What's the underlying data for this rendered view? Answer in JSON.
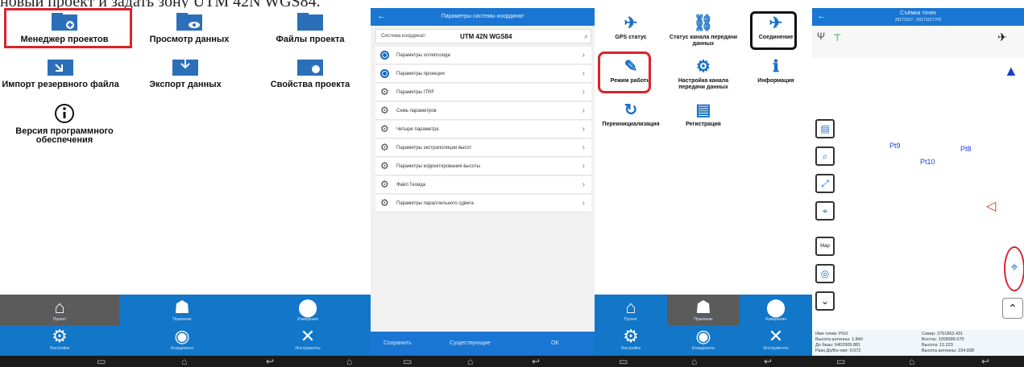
{
  "caption": "новый проект и задать зону UTM 42N WGS84.",
  "panel1": {
    "tiles": [
      "Менеджер проектов",
      "Просмотр данных",
      "Файлы проекта",
      "Импорт резервного файла",
      "Экспорт данных",
      "Свойства проекта",
      "Версия программного обеспечения"
    ],
    "bottom_tabs": [
      "Проект",
      "Приемник",
      "Измерения",
      "Настройки",
      "Координаты",
      "Инструменты"
    ]
  },
  "panel2": {
    "header_title": "Параметры системы координат",
    "coord_label": "Система координат:",
    "coord_value": "UTM 42N WGS84",
    "rows": [
      "Параметры эллипсоида",
      "Параметры проекции",
      "Параметры ITRF",
      "Семь параметров",
      "Четыре параметра",
      "Параметры экстраполяции высот",
      "Параметры корректирования высоты",
      "Файл Геоида",
      "Параметры параллельного сдвига"
    ],
    "footer": [
      "Сохранить",
      "Существующие",
      "ОК"
    ]
  },
  "panel3": {
    "tiles": [
      "GPS статус",
      "Статус канала передачи данных",
      "Соединение",
      "Режим работы",
      "Настройка канала передачи данных",
      "Информация",
      "Переинициализация",
      "Регистрация"
    ],
    "bottom_tabs": [
      "Проект",
      "Приемник",
      "Измерения",
      "Настройки",
      "Координаты",
      "Инструменты"
    ]
  },
  "panel4": {
    "title_line1": "Съёмка точек",
    "title_line2": "20171017 - 20171017 PD",
    "points": [
      "Pt9",
      "Pt8",
      "Pt10"
    ],
    "side_buttons": [
      "Map"
    ],
    "info": {
      "name": "Имя точки: Pt10",
      "antenna": "Высота антенны: 1.840",
      "lat": "До базы: 6402909.881",
      "pdop": "Разн.До/Бо-ния: 0.972",
      "north": "Север: 2751862.431",
      "east": "Восток: 1009999.070",
      "height": "Высота: 12.223",
      "hrms": "Высота антенны: 234.838"
    }
  },
  "colors": {
    "blue": "#1276c9",
    "red": "#d8242c"
  }
}
